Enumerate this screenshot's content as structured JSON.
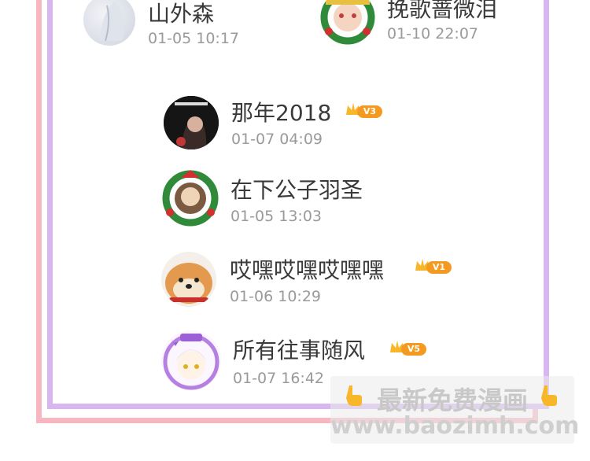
{
  "comments": [
    {
      "name": "山外森",
      "time": "01-05 10:17",
      "vip": "",
      "avatar": "pale-sketch-avatar"
    },
    {
      "name": "挽歌蔷微泪",
      "time": "01-10 22:07",
      "vip": "",
      "avatar": "christmas-wreath-avatar"
    },
    {
      "name": "那年2018",
      "time": "01-07 04:09",
      "vip": "V3",
      "avatar": "dark-portrait-avatar"
    },
    {
      "name": "在下公子羽圣",
      "time": "01-05 13:03",
      "vip": "",
      "avatar": "christmas-wreath-avatar"
    },
    {
      "name": "哎嘿哎嘿哎嘿嘿",
      "time": "01-06 10:29",
      "vip": "V1",
      "avatar": "shiba-dog-avatar"
    },
    {
      "name": "所有往事随风",
      "time": "01-07 16:42",
      "vip": "V5",
      "avatar": "anime-girl-avatar"
    }
  ],
  "watermark": {
    "title": "最新免费漫画",
    "url": "www.baozimh.com"
  },
  "colors": {
    "outer_frame": "#f7b6c0",
    "inner_frame": "#d8b7f0",
    "vip_badge": "#f59a20",
    "username": "#3a3a3a",
    "timestamp": "#9a9a9a"
  }
}
